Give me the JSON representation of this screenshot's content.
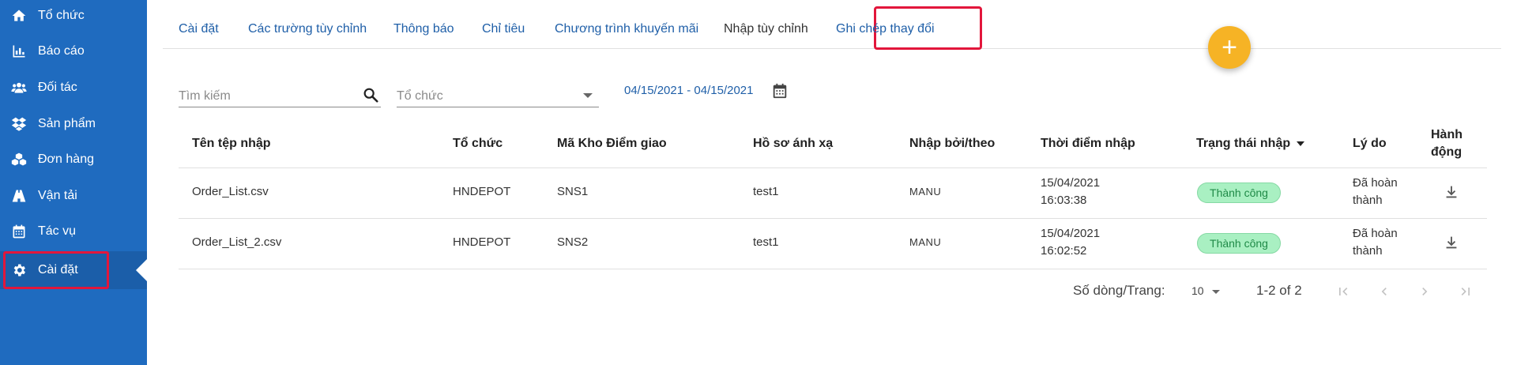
{
  "sidebar": {
    "items": [
      {
        "label": "Tổ chức",
        "icon": "home-icon"
      },
      {
        "label": "Báo cáo",
        "icon": "bar-chart-icon"
      },
      {
        "label": "Đối tác",
        "icon": "people-icon"
      },
      {
        "label": "Sản phẩm",
        "icon": "dropbox-icon"
      },
      {
        "label": "Đơn hàng",
        "icon": "boxes-icon"
      },
      {
        "label": "Vận tải",
        "icon": "road-icon"
      },
      {
        "label": "Tác vụ",
        "icon": "calendar-icon"
      },
      {
        "label": "Cài đặt",
        "icon": "gear-icon",
        "active": true
      }
    ]
  },
  "tabs": [
    {
      "label": "Cài đặt"
    },
    {
      "label": "Các trường tùy chỉnh"
    },
    {
      "label": "Thông báo"
    },
    {
      "label": "Chỉ tiêu"
    },
    {
      "label": "Chương trình khuyến mãi"
    },
    {
      "label": "Nhập tùy chỉnh",
      "active": true
    },
    {
      "label": "Ghi chép thay đổi"
    }
  ],
  "filters": {
    "search_placeholder": "Tìm kiếm",
    "org_placeholder": "Tổ chức",
    "date_range": "04/15/2021 - 04/15/2021"
  },
  "table": {
    "headers": {
      "file": "Tên tệp nhập",
      "org": "Tổ chức",
      "location": "Mã Kho Điểm giao",
      "profile": "Hồ sơ ánh xạ",
      "by": "Nhập bởi/theo",
      "time": "Thời điểm nhập",
      "status": "Trạng thái nhập",
      "reason": "Lý do",
      "action_line1": "Hành",
      "action_line2": "động"
    },
    "rows": [
      {
        "file": "Order_List.csv",
        "org": "HNDEPOT",
        "location": "SNS1",
        "profile": "test1",
        "by": "MANU",
        "date": "15/04/2021",
        "time": "16:03:38",
        "status": "Thành công",
        "reason1": "Đã hoàn",
        "reason2": "thành"
      },
      {
        "file": "Order_List_2.csv",
        "org": "HNDEPOT",
        "location": "SNS2",
        "profile": "test1",
        "by": "MANU",
        "date": "15/04/2021",
        "time": "16:02:52",
        "status": "Thành công",
        "reason1": "Đã hoàn",
        "reason2": "thành"
      }
    ]
  },
  "pagination": {
    "rows_label": "Số dòng/Trang:",
    "rows_value": "10",
    "count": "1-2 of 2"
  },
  "colors": {
    "sidebar": "#1f6bbf",
    "link": "#1f5fa8",
    "fab": "#f6b325",
    "highlight": "#e2163b",
    "success_bg": "#a9f0c2"
  }
}
